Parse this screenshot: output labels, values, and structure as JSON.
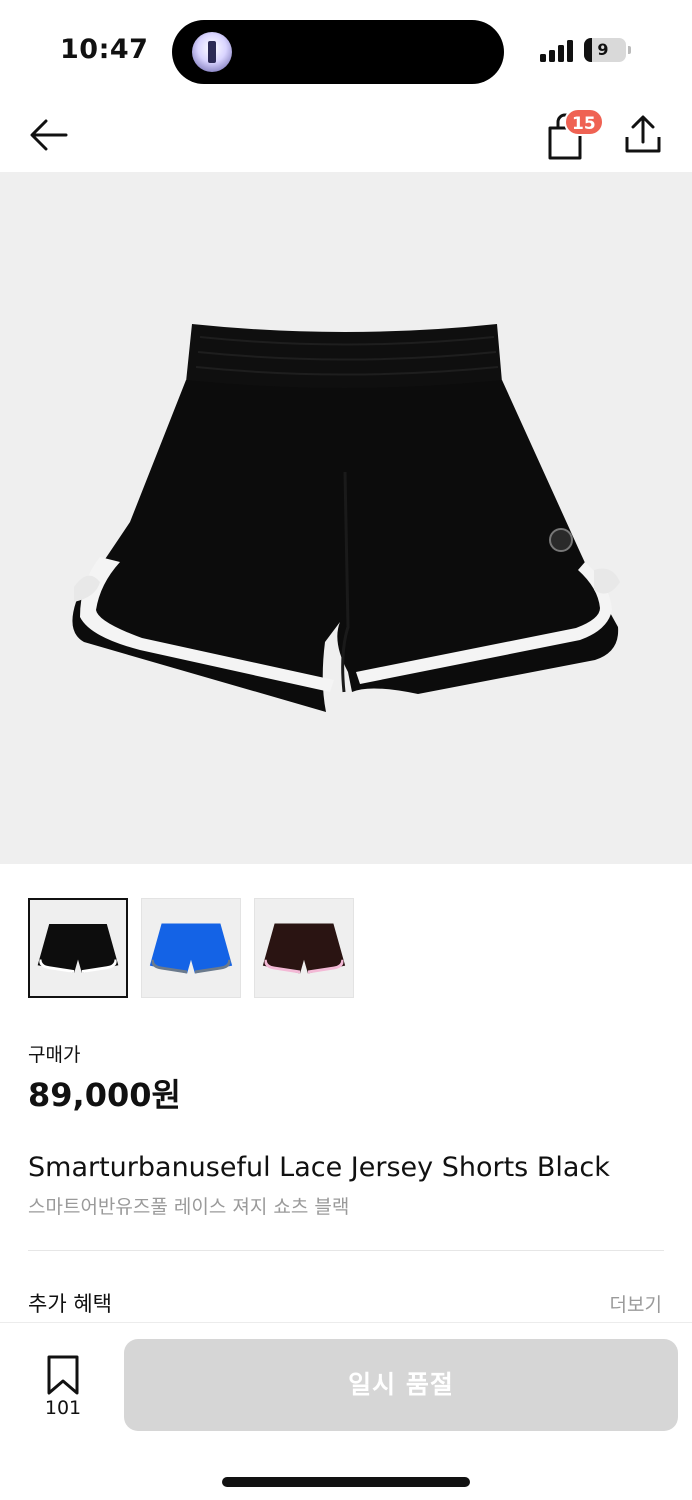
{
  "status_bar": {
    "time": "10:47",
    "battery": "9"
  },
  "nav": {
    "back_icon": "arrow-left-icon",
    "bag_icon": "shopping-bag-icon",
    "bag_badge": "15",
    "share_icon": "share-icon"
  },
  "product": {
    "hero_image": "black-lace-jersey-shorts",
    "thumbnails": [
      {
        "name": "black",
        "color": "#0d0d0d",
        "trim": "#ffffff"
      },
      {
        "name": "blue",
        "color": "#1463e6",
        "trim": "#6b7a8c"
      },
      {
        "name": "brown",
        "color": "#2a1412",
        "trim": "#f3b9d6"
      }
    ],
    "price_label": "구매가",
    "price": "89,000원",
    "title_en": "Smarturbanuseful Lace Jersey Shorts Black",
    "title_ko": "스마트어반유즈풀 레이스 져지 쇼츠 블랙"
  },
  "benefits": {
    "label": "추가 혜택",
    "more": "더보기"
  },
  "bottom_bar": {
    "wish_icon": "bookmark-icon",
    "wish_count": "101",
    "buy_label": "일시 품절"
  },
  "colors": {
    "badge": "#ef6253",
    "disabled_button": "#d6d6d6",
    "secondary_text": "#9a9a9a",
    "hero_bg": "#efefef"
  }
}
